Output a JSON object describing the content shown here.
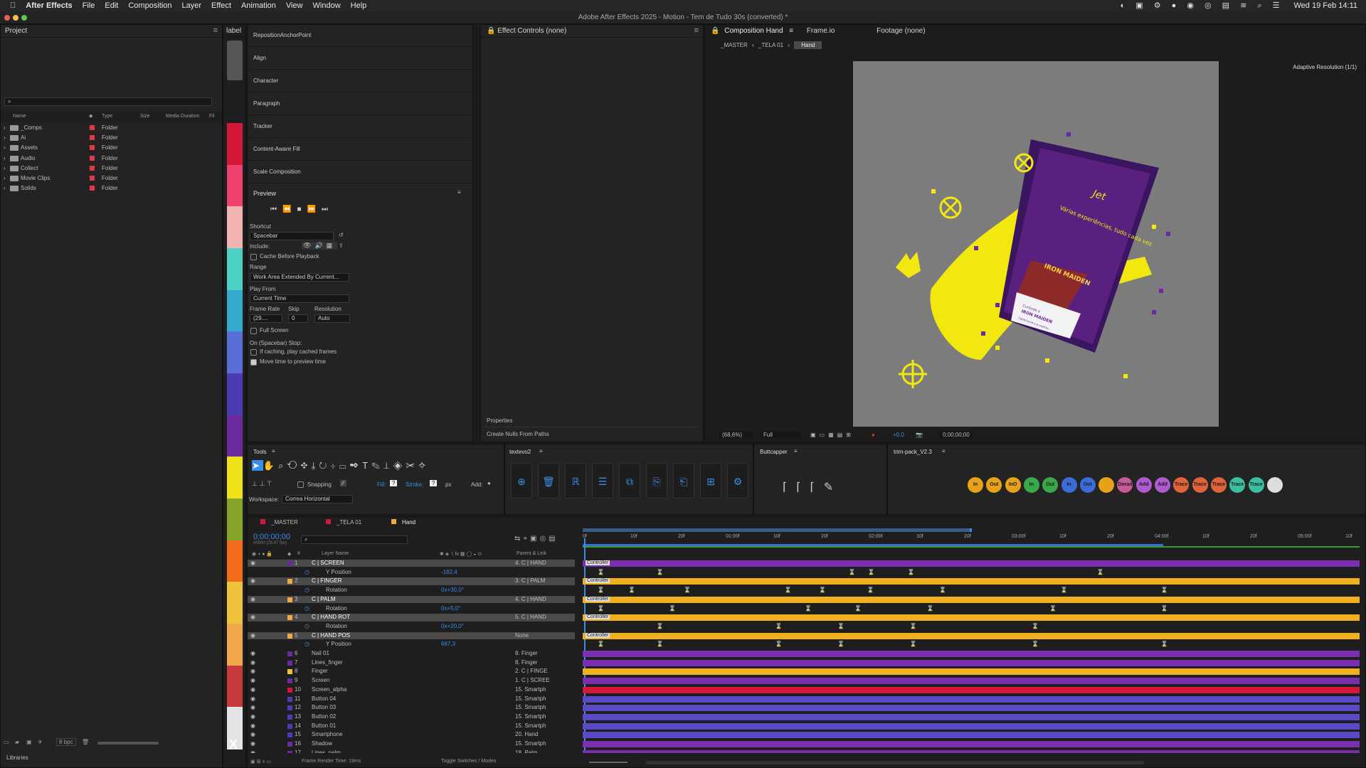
{
  "menubar": {
    "app": "After Effects",
    "items": [
      "File",
      "Edit",
      "Composition",
      "Layer",
      "Effect",
      "Animation",
      "View",
      "Window",
      "Help"
    ],
    "datetime": "Wed 19 Feb  14:11"
  },
  "window_title": "Adobe After Effects 2025 - Motion - Tem de Tudo 30s (converted) *",
  "project": {
    "title": "Project",
    "label_tab": "label",
    "columns": [
      "Name",
      "Type",
      "Size",
      "Media Duration",
      "Fil"
    ],
    "items": [
      {
        "name": "_Comps",
        "type": "Folder",
        "color": "#e2364a"
      },
      {
        "name": "Ai",
        "type": "Folder",
        "color": "#e2364a"
      },
      {
        "name": "Assets",
        "type": "Folder",
        "color": "#e2364a"
      },
      {
        "name": "Audio",
        "type": "Folder",
        "color": "#e2364a"
      },
      {
        "name": "Collect",
        "type": "Folder",
        "color": "#e2364a"
      },
      {
        "name": "Movie Clips",
        "type": "Folder",
        "color": "#e2364a"
      },
      {
        "name": "Solids",
        "type": "Folder",
        "color": "#e2364a"
      }
    ],
    "bpc": "8 bpc",
    "libraries": "Libraries"
  },
  "label_colors": [
    "#e3e3e3",
    "#c53b3b",
    "#f2a84a",
    "#eec23a",
    "#f26a1c",
    "#86a428",
    "#eee219",
    "#6b29a0",
    "#4b3cb4",
    "#5a6ed8",
    "#36a9cf",
    "#4fd0c4",
    "#f2b3b3",
    "#ee3f6e",
    "#d6173a"
  ],
  "side_panels": {
    "items": [
      "RepositionAnchorPoint",
      "Align",
      "Character",
      "Paragraph",
      "Tracker",
      "Content-Aware Fill",
      "Scale Composition"
    ]
  },
  "preview": {
    "title": "Preview",
    "shortcut_label": "Shortcut",
    "shortcut": "Spacebar",
    "include_label": "Include:",
    "cache": "Cache Before Playback",
    "range_label": "Range",
    "range": "Work Area Extended By Current...",
    "playfrom_label": "Play From",
    "playfrom": "Current Time",
    "framerate_label": "Frame Rate",
    "skip_label": "Skip",
    "resolution_label": "Resolution",
    "framerate": "(29....",
    "skip": "0",
    "resolution": "Auto",
    "fullscreen": "Full Screen",
    "stop_label": "On (Spacebar) Stop:",
    "if_caching": "If caching, play cached frames",
    "move_time": "Move time to preview time"
  },
  "effect_controls": {
    "title": "Effect Controls (none)",
    "properties": "Properties",
    "create_nulls": "Create Nulls From Paths"
  },
  "composition": {
    "title": "Composition Hand",
    "tab2": "Frame.io",
    "tab3": "Footage (none)",
    "crumbs": [
      "_MASTER",
      "_TELA 01",
      "Hand"
    ],
    "adaptive": "Adaptive Resolution (1/1)",
    "zoom": "(68,6%)",
    "quality": "Full",
    "exposure": "+0,0",
    "timecode": "0;00;00;00"
  },
  "canvas_text": {
    "jet": "Jet",
    "headline": "Várias experiências, tudo cada vez",
    "band": "IRON MAIDEN",
    "card_line1": "Curtindo o",
    "card_line2": "IRON MAIDEN",
    "card_line3": "Cada turnê e a melhor..."
  },
  "tools": {
    "title": "Tools",
    "snapping": "Snapping",
    "fill": "Fill:",
    "stroke": "Stroke:",
    "px": "px",
    "add": "Add:",
    "workspace_label": "Workspace:",
    "workspace": "Correa Horizontal"
  },
  "textevo": {
    "title": "textevo2"
  },
  "buttcapper": {
    "title": "Buttcapper"
  },
  "trimpack": {
    "title": "trim-pack_V2.3",
    "buttons": [
      {
        "t": "In",
        "c": "#e8a21a"
      },
      {
        "t": "Out",
        "c": "#e8a21a"
      },
      {
        "t": "InO",
        "c": "#e8a21a"
      },
      {
        "t": "In",
        "c": "#3aa84a"
      },
      {
        "t": "Out",
        "c": "#3aa84a"
      },
      {
        "t": "In",
        "c": "#3a6bd6"
      },
      {
        "t": "Out",
        "c": "#3a6bd6"
      },
      {
        "t": "",
        "c": "#e8a21a"
      },
      {
        "t": "Dorad",
        "c": "#c75a9a"
      },
      {
        "t": "Add",
        "c": "#b05ad0"
      },
      {
        "t": "Add",
        "c": "#b05ad0"
      },
      {
        "t": "Trace",
        "c": "#e0643a"
      },
      {
        "t": "Trace",
        "c": "#e0643a"
      },
      {
        "t": "Trace",
        "c": "#e0643a"
      },
      {
        "t": "Trace",
        "c": "#3ac0a0"
      },
      {
        "t": "Trace",
        "c": "#3ac0a0"
      },
      {
        "t": "",
        "c": "#dddddd"
      }
    ]
  },
  "timeline": {
    "tabs": [
      "_MASTER",
      "_TELA 01",
      "Hand"
    ],
    "tab_colors": [
      "#d6173a",
      "#d6173a",
      "#f2a84a"
    ],
    "timecode": "0;00;00;00",
    "fps": "00000 (29.97 fps)",
    "col_layer": "Layer Name",
    "col_parent": "Parent & Link",
    "ruler": [
      "0f",
      "10f",
      "20f",
      "01:00f",
      "10f",
      "20f",
      "02:00f",
      "10f",
      "20f",
      "03:00f",
      "10f",
      "20f",
      "04:00f",
      "10f",
      "20f",
      "05:00f",
      "10f"
    ],
    "rows": [
      {
        "n": "1",
        "name": "C | SCREEN",
        "val": "",
        "parent": "4. C | HAND",
        "color": "#6b29a0",
        "sel": true,
        "bar": "#7a2fb0",
        "type": "layer"
      },
      {
        "n": "",
        "name": "Y Position",
        "val": "-182,4",
        "parent": "",
        "color": "",
        "sel": false,
        "bar": "",
        "type": "prop"
      },
      {
        "n": "2",
        "name": "C | FINGER",
        "val": "",
        "parent": "3. C | PALM",
        "color": "#f2a84a",
        "sel": true,
        "bar": "#f0b020",
        "type": "layer"
      },
      {
        "n": "",
        "name": "Rotation",
        "val": "0x+30,0°",
        "parent": "",
        "color": "",
        "sel": false,
        "bar": "",
        "type": "prop"
      },
      {
        "n": "3",
        "name": "C | PALM",
        "val": "",
        "parent": "4. C | HAND",
        "color": "#f2a84a",
        "sel": true,
        "bar": "#f0b020",
        "type": "layer"
      },
      {
        "n": "",
        "name": "Rotation",
        "val": "0x+5,0°",
        "parent": "",
        "color": "",
        "sel": false,
        "bar": "",
        "type": "prop"
      },
      {
        "n": "4",
        "name": "C | HAND ROT",
        "val": "",
        "parent": "5. C | HAND",
        "color": "#f2a84a",
        "sel": true,
        "bar": "#f0b020",
        "type": "layer"
      },
      {
        "n": "",
        "name": "Rotation",
        "val": "0x+20,0°",
        "parent": "",
        "color": "",
        "sel": false,
        "bar": "",
        "type": "prop"
      },
      {
        "n": "5",
        "name": "C | HAND POS",
        "val": "",
        "parent": "None",
        "color": "#f2a84a",
        "sel": true,
        "bar": "#f0b020",
        "type": "layer"
      },
      {
        "n": "",
        "name": "Y Position",
        "val": "687,3",
        "parent": "",
        "color": "",
        "sel": false,
        "bar": "",
        "type": "prop"
      },
      {
        "n": "6",
        "name": "Nail 01",
        "val": "",
        "parent": "8. Finger",
        "color": "#6b29a0",
        "sel": false,
        "bar": "#7a2fb0",
        "type": "layer"
      },
      {
        "n": "7",
        "name": "Lines_finger",
        "val": "",
        "parent": "8. Finger",
        "color": "#6b29a0",
        "sel": false,
        "bar": "#7a2fb0",
        "type": "layer"
      },
      {
        "n": "8",
        "name": "Finger",
        "val": "",
        "parent": "2. C | FINGE",
        "color": "#eec23a",
        "sel": false,
        "bar": "#f0b020",
        "type": "layer"
      },
      {
        "n": "9",
        "name": "Screen",
        "val": "",
        "parent": "1. C | SCREE",
        "color": "#6b29a0",
        "sel": false,
        "bar": "#7a2fb0",
        "type": "layer"
      },
      {
        "n": "10",
        "name": "Screen_alpha",
        "val": "",
        "parent": "15. Smartph",
        "color": "#d6173a",
        "sel": false,
        "bar": "#d6173a",
        "type": "layer"
      },
      {
        "n": "11",
        "name": "Button 04",
        "val": "",
        "parent": "15. Smartph",
        "color": "#4b3cb4",
        "sel": false,
        "bar": "#5a4ac8",
        "type": "layer"
      },
      {
        "n": "12",
        "name": "Button 03",
        "val": "",
        "parent": "15. Smartph",
        "color": "#4b3cb4",
        "sel": false,
        "bar": "#5a4ac8",
        "type": "layer"
      },
      {
        "n": "13",
        "name": "Button 02",
        "val": "",
        "parent": "15. Smartph",
        "color": "#4b3cb4",
        "sel": false,
        "bar": "#5a4ac8",
        "type": "layer"
      },
      {
        "n": "14",
        "name": "Button 01",
        "val": "",
        "parent": "15. Smartph",
        "color": "#4b3cb4",
        "sel": false,
        "bar": "#5a4ac8",
        "type": "layer"
      },
      {
        "n": "15",
        "name": "Smartphone",
        "val": "",
        "parent": "20. Hand",
        "color": "#4b3cb4",
        "sel": false,
        "bar": "#5a4ac8",
        "type": "layer"
      },
      {
        "n": "16",
        "name": "Shadow",
        "val": "",
        "parent": "15. Smartph",
        "color": "#6b29a0",
        "sel": false,
        "bar": "#7a2fb0",
        "type": "layer"
      },
      {
        "n": "17",
        "name": "Lines_palm",
        "val": "",
        "parent": "18. Palm",
        "color": "#6b29a0",
        "sel": false,
        "bar": "#7a2fb0",
        "type": "layer"
      }
    ],
    "controller": "Controller",
    "render_time": "Frame Render Time:  19ms",
    "toggle": "Toggle Switches / Modes"
  }
}
